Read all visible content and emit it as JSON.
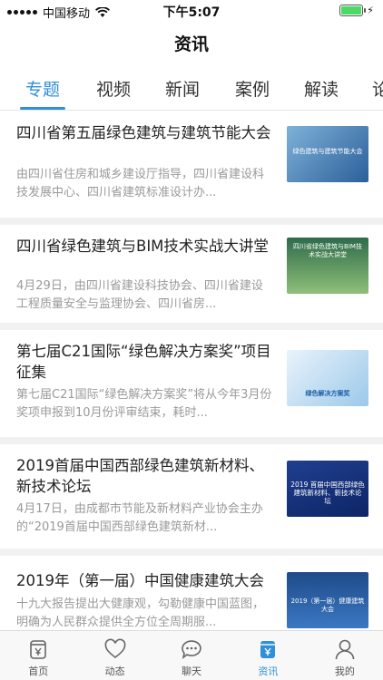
{
  "status": {
    "carrier": "中国移动",
    "time": "下午5:07"
  },
  "title": "资讯",
  "tabs": [
    "专题",
    "视频",
    "新闻",
    "案例",
    "解读",
    "论"
  ],
  "articles": [
    {
      "title": "四川省第五届绿色建筑与建筑节能大会",
      "desc": "由四川省住房和城乡建设厅指导，四川省建设科技发展中心、四川省建筑标准设计办...",
      "thumb_text": "绿色建筑与建筑节能大会"
    },
    {
      "title": "四川省绿色建筑与BIM技术实战大讲堂",
      "desc": "4月29日，由四川省建设科技协会、四川省建设工程质量安全与监理协会、四川省房...",
      "thumb_text": "四川省绿色建筑与BIM技术实战大讲堂"
    },
    {
      "title": "第七届C21国际“绿色解决方案奖”项目征集",
      "desc": "第七届C21国际“绿色解决方案奖”将从今年3月份奖项申报到10月份评审结束，耗时...",
      "thumb_text": "绿色解决方案奖"
    },
    {
      "title": "2019首届中国西部绿色建筑新材料、新技术论坛",
      "desc": "4月17日，由成都市节能及新材料产业协会主办的“2019首届中国西部绿色建筑新材...",
      "thumb_text": "2019 首届中国西部绿色建筑新材料、新技术论坛"
    },
    {
      "title": "2019年（第一届）中国健康建筑大会",
      "desc": "十九大报告提出大健康观，勾勒健康中国蓝图，明确为人民群众提供全方位全周期服...",
      "thumb_text": "2019（第一届）健康建筑大会"
    }
  ],
  "tabbar": [
    "首页",
    "动态",
    "聊天",
    "资讯",
    "我的"
  ],
  "colors": {
    "accent": "#2f8fd8",
    "divider": "#f1f1f1"
  }
}
